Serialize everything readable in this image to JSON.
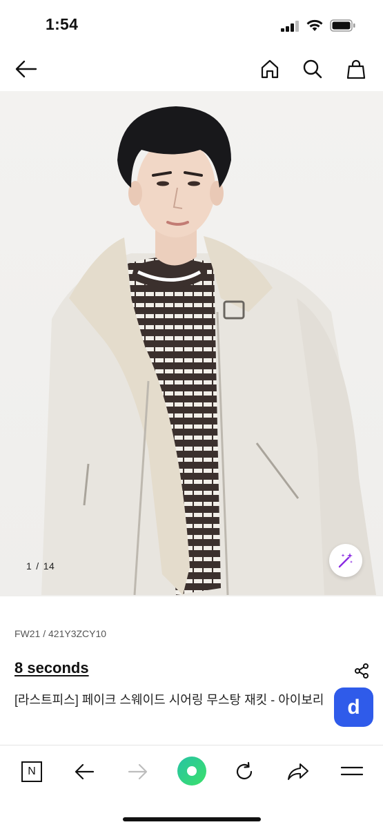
{
  "status_bar": {
    "time": "1:54"
  },
  "header": {
    "icons": [
      "back-arrow-icon",
      "home-icon",
      "search-icon",
      "shopping-bag-icon"
    ]
  },
  "gallery": {
    "current": "1",
    "separator": "/",
    "total": "14",
    "magic_icon": "magic-wand-icon"
  },
  "product": {
    "code": "FW21 / 421Y3ZCY10",
    "brand": "8 seconds",
    "title": "[라스트피스] 페이크 스웨이드 시어링 무스탕 재킷 - 아이보리",
    "badge_letter": "d",
    "badge_color": "#2f5bea"
  },
  "browser_bar": {
    "n_label": "N",
    "accent_color": "#2fd37b",
    "icons": [
      "naver-n-icon",
      "back-arrow-icon",
      "forward-arrow-icon",
      "green-home-dot-icon",
      "reload-icon",
      "share-arrow-icon",
      "menu-icon"
    ]
  }
}
